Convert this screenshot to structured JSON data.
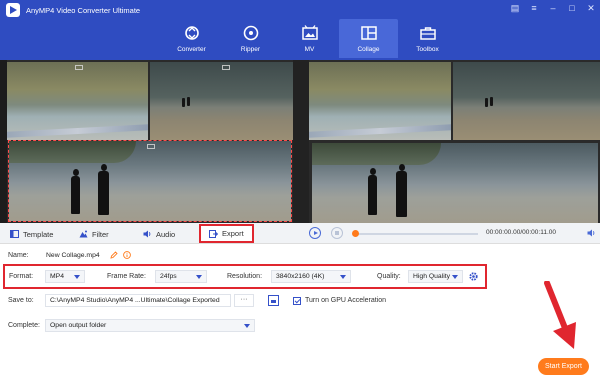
{
  "app": {
    "title": "AnyMP4 Video Converter Ultimate"
  },
  "nav": [
    {
      "label": "Converter",
      "icon": "converter-icon"
    },
    {
      "label": "Ripper",
      "icon": "ripper-icon"
    },
    {
      "label": "MV",
      "icon": "mv-icon"
    },
    {
      "label": "Collage",
      "icon": "collage-icon",
      "active": true
    },
    {
      "label": "Toolbox",
      "icon": "toolbox-icon"
    }
  ],
  "tabs": [
    {
      "label": "Template",
      "icon": "template-icon"
    },
    {
      "label": "Filter",
      "icon": "filter-icon"
    },
    {
      "label": "Audio",
      "icon": "audio-icon"
    },
    {
      "label": "Export",
      "icon": "export-icon",
      "active": true
    }
  ],
  "player": {
    "time": "00:00:00.00/00:00:11.00",
    "progress": 0
  },
  "settings": {
    "name_label": "Name:",
    "name_value": "New Collage.mp4",
    "format_label": "Format:",
    "format_value": "MP4",
    "frame_rate_label": "Frame Rate:",
    "frame_rate_value": "24fps",
    "resolution_label": "Resolution:",
    "resolution_value": "3840x2160 (4K)",
    "quality_label": "Quality:",
    "quality_value": "High Quality",
    "save_to_label": "Save to:",
    "save_to_value": "C:\\AnyMP4 Studio\\AnyMP4 ...Ultimate\\Collage Exported",
    "browse_label": "···",
    "gpu_label": "Turn on GPU Acceleration",
    "gpu_checked": true,
    "complete_label": "Complete:",
    "complete_value": "Open output folder"
  },
  "actions": {
    "start_export": "Start Export"
  },
  "colors": {
    "header": "#2f4cc1",
    "accent": "#ff7b1c",
    "highlight": "#e0262f"
  }
}
